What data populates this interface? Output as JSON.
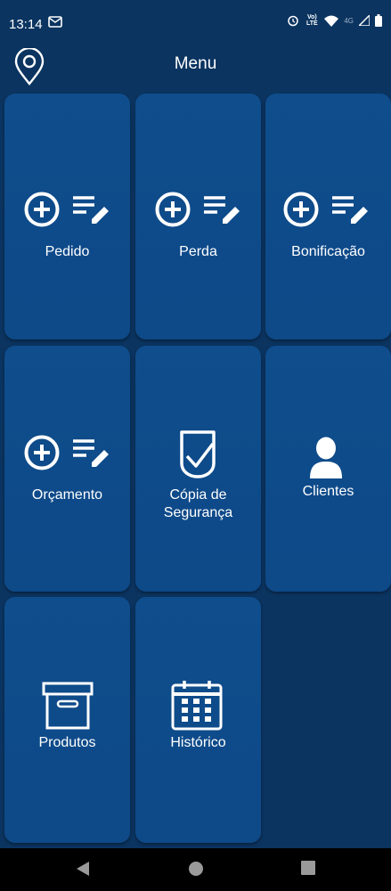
{
  "status_bar": {
    "time": "13:14",
    "volte_label": "Vo) LTE",
    "network_label": "4G"
  },
  "app_bar": {
    "title": "Menu"
  },
  "menu": {
    "pedido": "Pedido",
    "perda": "Perda",
    "bonificacao": "Bonificação",
    "orcamento": "Orçamento",
    "copia_line1": "Cópia de",
    "copia_line2": "Segurança",
    "clientes": "Clientes",
    "produtos": "Produtos",
    "historico": "Histórico"
  },
  "colors": {
    "background": "#0b3460",
    "tile": "#0f4d8c",
    "icon": "#ffffff"
  }
}
